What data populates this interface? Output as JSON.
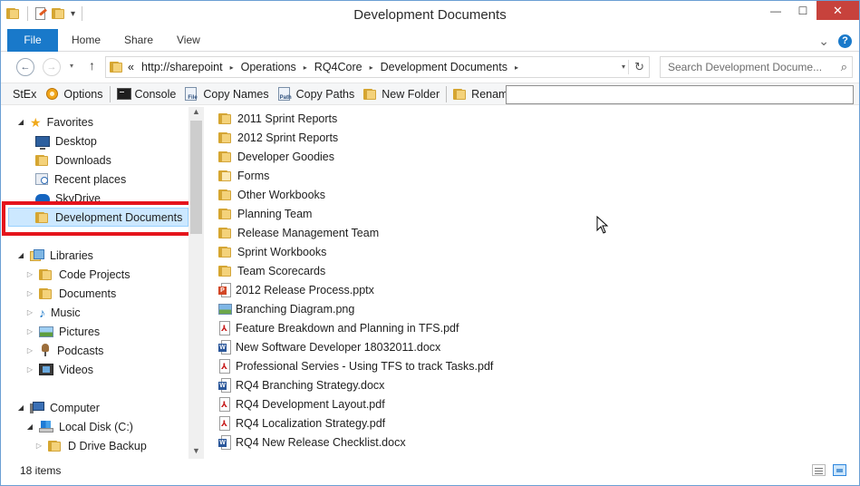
{
  "window": {
    "title": "Development Documents"
  },
  "quick_access": {
    "customize_glyph": "▾"
  },
  "controls": {
    "minimize": "—",
    "maximize": "☐",
    "close": "✕"
  },
  "ribbon": {
    "tabs": [
      "File",
      "Home",
      "Share",
      "View"
    ],
    "expand_glyph": "⌄",
    "help_glyph": "?"
  },
  "nav": {
    "back_glyph": "←",
    "forward_glyph": "→",
    "recent_glyph": "▾",
    "up_glyph": "↑"
  },
  "address": {
    "overflow": "«",
    "crumbs": [
      "http://sharepoint",
      "Operations",
      "RQ4Core",
      "Development Documents"
    ],
    "sep_glyph": "▸",
    "dropdown_glyph": "▾",
    "refresh_glyph": "↻"
  },
  "search": {
    "placeholder": "Search Development Docume...",
    "icon_glyph": "⌕"
  },
  "stexbar": {
    "label": "StEx",
    "options": "Options",
    "console": "Console",
    "copy_names": "Copy Names",
    "copy_paths": "Copy Paths",
    "new_folder": "New Folder",
    "rename": "Rename",
    "command_value": ""
  },
  "tree": {
    "favorites": "Favorites",
    "desktop": "Desktop",
    "downloads": "Downloads",
    "recent_places": "Recent places",
    "skydrive": "SkyDrive",
    "development_documents": "Development Documents",
    "libraries": "Libraries",
    "code_projects": "Code Projects",
    "documents": "Documents",
    "music": "Music",
    "pictures": "Pictures",
    "podcasts": "Podcasts",
    "videos": "Videos",
    "computer": "Computer",
    "local_disk": "Local Disk (C:)",
    "d_drive_backup": "D Drive Backup",
    "expanded_glyph": "◢",
    "collapsed_glyph": "▷"
  },
  "scroll": {
    "up_glyph": "▲",
    "down_glyph": "▼"
  },
  "files": [
    {
      "name": "2011 Sprint Reports",
      "icon": "folder-icon"
    },
    {
      "name": "2012 Sprint Reports",
      "icon": "folder-icon"
    },
    {
      "name": "Developer Goodies",
      "icon": "folder-icon"
    },
    {
      "name": "Forms",
      "icon": "folder-icon"
    },
    {
      "name": "Other Workbooks",
      "icon": "folder-icon"
    },
    {
      "name": "Planning Team",
      "icon": "folder-icon"
    },
    {
      "name": "Release Management Team",
      "icon": "folder-icon"
    },
    {
      "name": "Sprint Workbooks",
      "icon": "folder-icon"
    },
    {
      "name": "Team Scorecards",
      "icon": "folder-icon"
    },
    {
      "name": "2012 Release Process.pptx",
      "icon": "pptx-icon"
    },
    {
      "name": "Branching Diagram.png",
      "icon": "png-icon"
    },
    {
      "name": "Feature Breakdown and Planning in TFS.pdf",
      "icon": "pdf-icon"
    },
    {
      "name": "New Software Developer 18032011.docx",
      "icon": "docx-icon"
    },
    {
      "name": "Professional Servies - Using TFS to track Tasks.pdf",
      "icon": "pdf-icon"
    },
    {
      "name": "RQ4 Branching Strategy.docx",
      "icon": "docx-icon"
    },
    {
      "name": "RQ4 Development Layout.pdf",
      "icon": "pdf-icon"
    },
    {
      "name": "RQ4 Localization Strategy.pdf",
      "icon": "pdf-icon"
    },
    {
      "name": "RQ4 New Release Checklist.docx",
      "icon": "docx-icon"
    }
  ],
  "status": {
    "item_count": "18 items"
  },
  "colors": {
    "accent": "#1979ca",
    "selection": "#cce8ff",
    "highlight_box": "#e5141c",
    "close_button": "#c7423c"
  }
}
